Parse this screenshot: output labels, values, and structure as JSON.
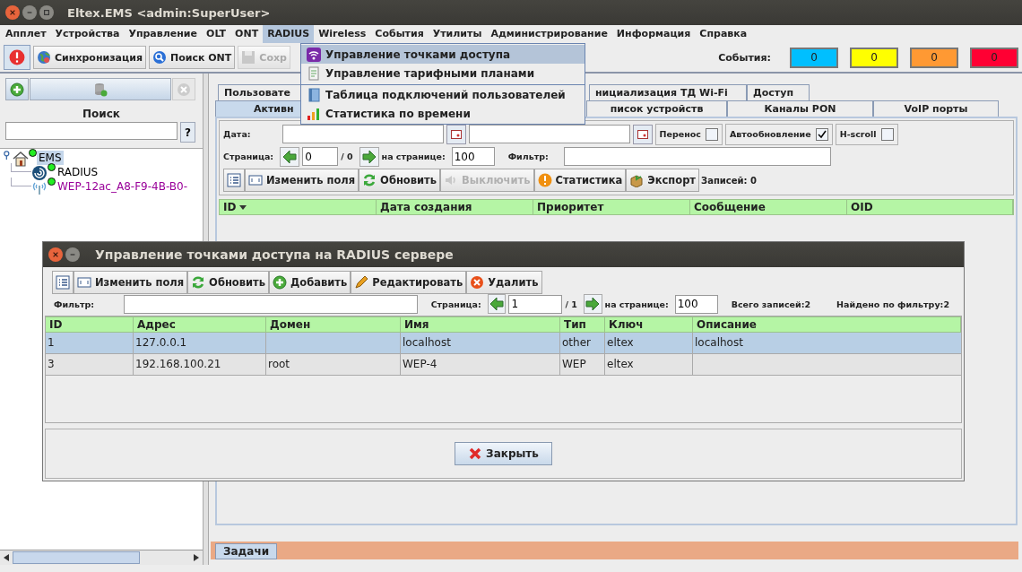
{
  "window": {
    "title": "Eltex.EMS <admin:SuperUser>"
  },
  "menu_bar": [
    {
      "label": "Апплет",
      "selected": false
    },
    {
      "label": "Устройства",
      "selected": false
    },
    {
      "label": "Управление",
      "selected": false
    },
    {
      "label": "OLT",
      "selected": false
    },
    {
      "label": "ONT",
      "selected": false
    },
    {
      "label": "RADIUS",
      "selected": true
    },
    {
      "label": "Wireless",
      "selected": false
    },
    {
      "label": "События",
      "selected": false
    },
    {
      "label": "Утилиты",
      "selected": false
    },
    {
      "label": "Администрирование",
      "selected": false
    },
    {
      "label": "Информация",
      "selected": false
    },
    {
      "label": "Справка",
      "selected": false
    }
  ],
  "open_menu": [
    {
      "label": "Управление точками доступа",
      "selected": true,
      "divider_above": false
    },
    {
      "label": "Управление тарифными планами",
      "selected": false,
      "divider_above": false
    },
    {
      "label": "Таблица подключений пользователей",
      "selected": false,
      "divider_above": true
    },
    {
      "label": "Статистика по времени",
      "selected": false,
      "divider_above": false
    }
  ],
  "toolbar": [
    {
      "label": "Синхронизация",
      "disabled": false
    },
    {
      "label": "Поиск ONT",
      "disabled": false
    },
    {
      "label": "Сохр",
      "disabled": true
    }
  ],
  "events": {
    "label": "События:",
    "counters": [
      {
        "value": "0",
        "color": "#00bfff"
      },
      {
        "value": "0",
        "color": "#ffff00"
      },
      {
        "value": "0",
        "color": "#ff9933"
      },
      {
        "value": "0",
        "color": "#ff0033"
      }
    ]
  },
  "left_panel": {
    "search_label": "Поиск",
    "help_button": "?",
    "tree": [
      {
        "label": "EMS",
        "selected": true,
        "color": "#000000",
        "children": [
          {
            "label": "RADIUS",
            "selected": false,
            "color": "#000000"
          },
          {
            "label": "WEP-12ac_A8-F9-4B-B0-",
            "selected": false,
            "color": "#990099"
          }
        ]
      }
    ]
  },
  "tabs": {
    "row_1": [
      {
        "label": "Пользовате",
        "selected": false
      },
      {
        "label": "нициализация ТД Wi-Fi",
        "selected": false
      },
      {
        "label": "Доступ",
        "selected": false
      }
    ],
    "row_2": [
      {
        "label": "Активн",
        "selected": true
      },
      {
        "label": "писок устройств",
        "selected": false
      },
      {
        "label": "Каналы PON",
        "selected": false
      },
      {
        "label": "VoIP порты",
        "selected": false
      }
    ]
  },
  "filters": {
    "date_label": "Дата:",
    "checkboxes": [
      {
        "label": "Перенос",
        "checked": false
      },
      {
        "label": "Автообновление",
        "checked": true
      },
      {
        "label": "H-scroll",
        "checked": false
      }
    ],
    "page_label": "Страница:",
    "page": "0",
    "page_total": "/ 0",
    "per_page_label": "на странице:",
    "per_page": "100",
    "filter_label": "Фильтр:"
  },
  "actions": [
    {
      "label": "Изменить поля",
      "disabled": false
    },
    {
      "label": "Обновить",
      "disabled": false
    },
    {
      "label": "Выключить",
      "disabled": true
    },
    {
      "label": "Статистика",
      "disabled": false
    },
    {
      "label": "Экспорт",
      "disabled": false
    }
  ],
  "records": "Записей: 0",
  "table": {
    "columns": [
      "ID",
      "Дата создания",
      "Приоритет",
      "Сообщение",
      "OID"
    ]
  },
  "dialog": {
    "title": "Управление точками доступа на RADIUS сервере",
    "actions": [
      {
        "label": "Изменить поля"
      },
      {
        "label": "Обновить"
      },
      {
        "label": "Добавить"
      },
      {
        "label": "Редактировать"
      },
      {
        "label": "Удалить"
      }
    ],
    "filter_label": "Фильтр:",
    "page_label": "Страница:",
    "page": "1",
    "page_total": "/ 1",
    "per_page_label": "на странице:",
    "per_page": "100",
    "total": "Всего записей:2",
    "found": "Найдено по фильтру:2",
    "columns": [
      "ID",
      "Адрес",
      "Домен",
      "Имя",
      "Тип",
      "Ключ",
      "Описание"
    ],
    "rows": [
      {
        "cells": [
          "1",
          "127.0.0.1",
          "",
          "localhost",
          "other",
          "eltex",
          "localhost"
        ],
        "selected": true
      },
      {
        "cells": [
          "3",
          "192.168.100.21",
          "root",
          "WEP-4",
          "WEP",
          "eltex",
          ""
        ],
        "selected": false
      }
    ],
    "close_button": "Закрыть"
  },
  "tasks_tab": "Задачи"
}
